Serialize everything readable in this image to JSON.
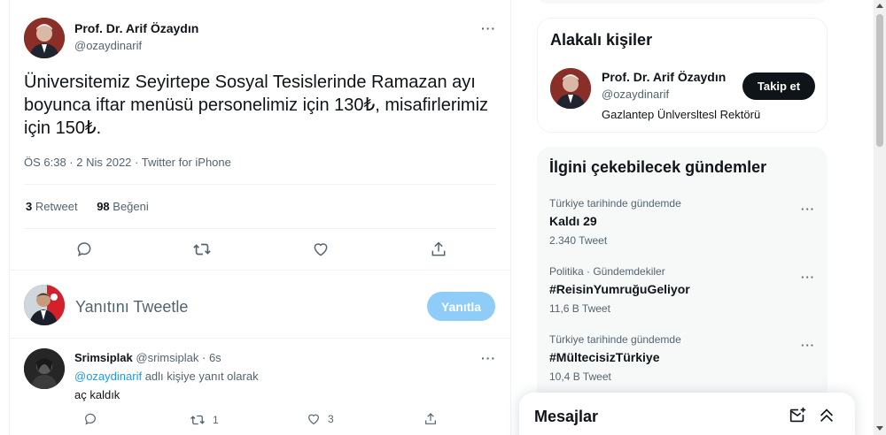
{
  "tweet": {
    "author_name": "Prof. Dr. Arif Özaydın",
    "author_handle": "@ozaydinarif",
    "text": "Üniversitemiz Seyirtepe Sosyal Tesislerinde Ramazan ayı boyunca iftar menüsü personelimiz için 130₺, misafirlerimiz için 150₺.",
    "meta": "ÖS 6:38 · 2 Nis 2022 · Twitter for iPhone",
    "retweet_count": "3",
    "retweet_label": "Retweet",
    "like_count": "98",
    "like_label": "Beğeni",
    "more_label": "···"
  },
  "reply_compose": {
    "placeholder": "Yanıtını Tweetle",
    "button_label": "Yanıtla"
  },
  "reply": {
    "name": "Srimsiplak",
    "handle": "@srimsiplak",
    "time": "· 6s",
    "replying_prefix": "@ozaydinarif",
    "replying_suffix": " adlı kişiye yanıt olarak",
    "text": "aç kaldık",
    "retweets": "1",
    "likes": "3",
    "more_label": "···"
  },
  "related_people": {
    "title": "Alakalı kişiler",
    "name": "Prof. Dr. Arif Özaydın",
    "handle": "@ozaydinarif",
    "bio": "Gazlantep Ünlversltesl Rektörü",
    "follow_label": "Takip et"
  },
  "trends": {
    "title": "İlgini çekebilecek gündemler",
    "items": [
      {
        "context": "Türkiye tarihinde gündemde",
        "name": "Kaldı 29",
        "count": "2.340 Tweet"
      },
      {
        "context": "Politika · Gündemdekiler",
        "name": "#ReisinYumruğuGeliyor",
        "count": "11,6 B Tweet"
      },
      {
        "context": "Türkiye tarihinde gündemde",
        "name": "#MültecisizTürkiye",
        "count": "10,4 B Tweet"
      }
    ],
    "more_label": "···"
  },
  "messages": {
    "title": "Mesajlar"
  },
  "icons": {
    "reply": "reply-icon",
    "retweet": "retweet-icon",
    "like": "heart-icon",
    "share": "share-icon",
    "new_message": "new-message-icon",
    "collapse": "chevron-up-double-icon"
  },
  "colors": {
    "accent": "#1d9bf0",
    "reply_button": "#8ecdf8",
    "follow_button": "#0f1419"
  }
}
